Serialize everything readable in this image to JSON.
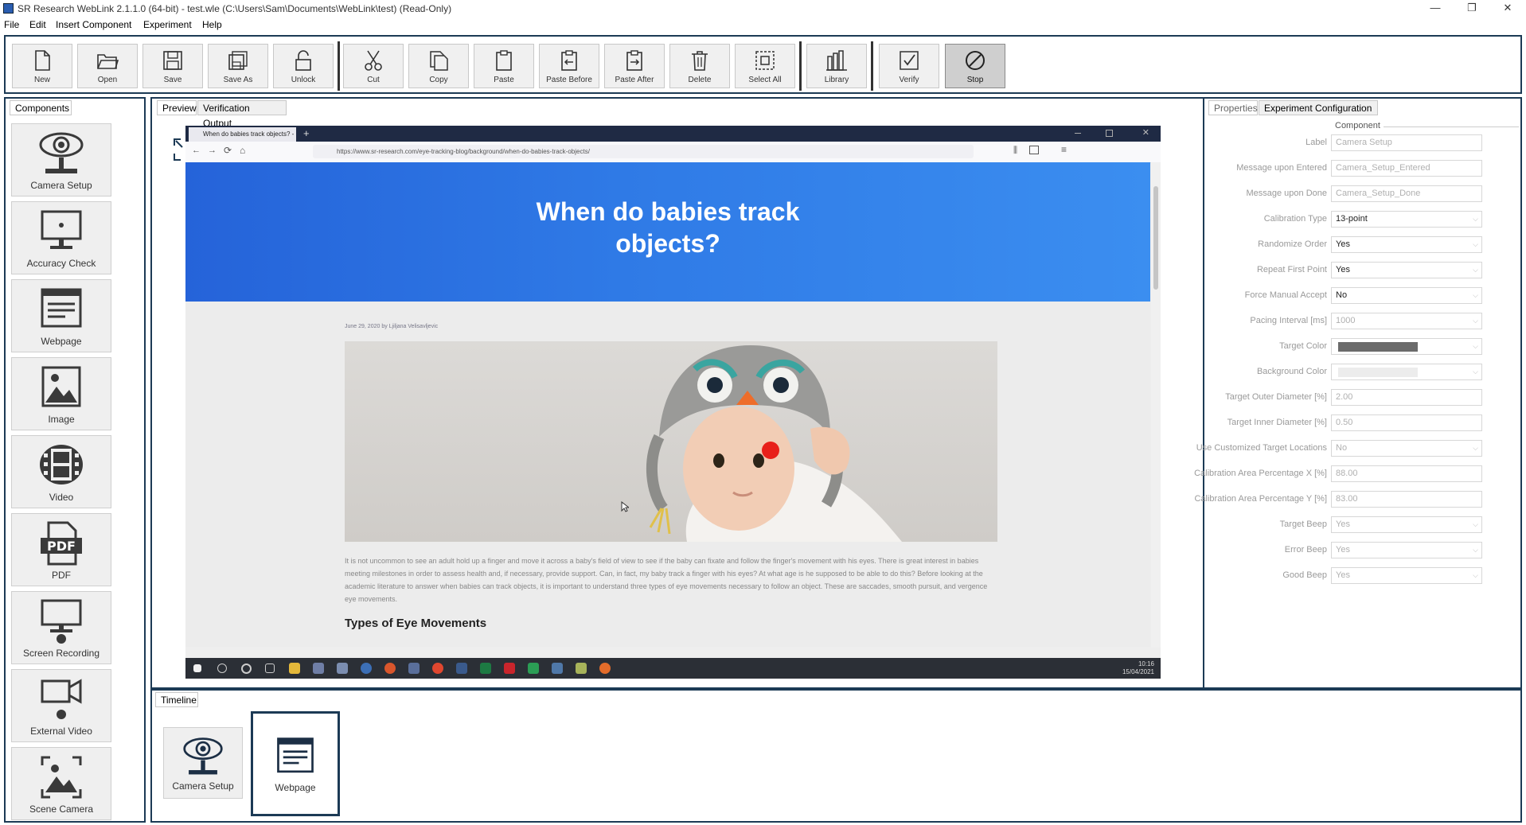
{
  "window": {
    "title": "SR Research WebLink 2.1.1.0 (64-bit) - test.wle (C:\\Users\\Sam\\Documents\\WebLink\\test) (Read-Only)",
    "controls": [
      "—",
      "❐",
      "✕"
    ]
  },
  "menu": [
    "File",
    "Edit",
    "Insert Component",
    "Experiment",
    "Help"
  ],
  "toolbar": [
    {
      "label": "New",
      "icon": "new-file-icon"
    },
    {
      "label": "Open",
      "icon": "folder-open-icon"
    },
    {
      "label": "Save",
      "icon": "save-icon"
    },
    {
      "label": "Save As",
      "icon": "save-as-icon"
    },
    {
      "label": "Unlock",
      "icon": "unlock-icon"
    },
    {
      "label": "Cut",
      "icon": "scissors-icon"
    },
    {
      "label": "Copy",
      "icon": "copy-icon"
    },
    {
      "label": "Paste",
      "icon": "clipboard-icon"
    },
    {
      "label": "Paste Before",
      "icon": "paste-before-icon"
    },
    {
      "label": "Paste After",
      "icon": "paste-after-icon"
    },
    {
      "label": "Delete",
      "icon": "trash-icon"
    },
    {
      "label": "Select All",
      "icon": "select-all-icon"
    },
    {
      "label": "Library",
      "icon": "library-icon"
    },
    {
      "label": "Verify",
      "icon": "check-icon"
    },
    {
      "label": "Stop",
      "icon": "stop-icon"
    }
  ],
  "components_panel": {
    "tab": "Components",
    "items": [
      "Camera Setup",
      "Accuracy Check",
      "Webpage",
      "Image",
      "Video",
      "PDF",
      "Screen Recording",
      "External Video",
      "Scene Camera"
    ]
  },
  "preview_panel": {
    "tabs": [
      "Preview",
      "Verification Output"
    ],
    "browser": {
      "tab_title": "When do babies track objects? -",
      "new_tab": "+",
      "url": "https://www.sr-research.com/eye-tracking-blog/background/when-do-babies-track-objects/",
      "hero_title": "When do babies track objects?",
      "byline": "June 29, 2020 by Ljiljana Velisavljevic",
      "body_text": "It is not uncommon to see an adult hold up a finger and move it across a baby's field of view to see if the baby can fixate and follow the finger's movement with his eyes. There is great interest in babies meeting milestones in order to assess health and, if necessary, provide support. Can, in fact, my baby track a finger with his eyes? At what age is he supposed to be able to do this? Before looking at the academic literature to answer when babies can track objects, it is important to understand three types of eye movements necessary to follow an object. These are saccades, smooth pursuit, and vergence eye movements.",
      "section_heading": "Types of Eye Movements",
      "clock_time": "10:16",
      "clock_date": "15/04/2021"
    }
  },
  "properties_panel": {
    "tabs": [
      "Properties",
      "Experiment Configuration"
    ],
    "group": "Component",
    "rows": [
      {
        "label": "Label",
        "value": "Camera Setup",
        "type": "text"
      },
      {
        "label": "Message upon Entered",
        "value": "Camera_Setup_Entered",
        "type": "text"
      },
      {
        "label": "Message upon Done",
        "value": "Camera_Setup_Done",
        "type": "text"
      },
      {
        "label": "Calibration Type",
        "value": "13-point",
        "type": "select"
      },
      {
        "label": "Randomize Order",
        "value": "Yes",
        "type": "select"
      },
      {
        "label": "Repeat First Point",
        "value": "Yes",
        "type": "select"
      },
      {
        "label": "Force Manual Accept",
        "value": "No",
        "type": "select"
      },
      {
        "label": "Pacing Interval [ms]",
        "value": "1000",
        "type": "select"
      },
      {
        "label": "Target Color",
        "value": "",
        "type": "color",
        "color": "#6b6b6b"
      },
      {
        "label": "Background Color",
        "value": "",
        "type": "color",
        "color": "#ececec"
      },
      {
        "label": "Target Outer Diameter [%]",
        "value": "2.00",
        "type": "text"
      },
      {
        "label": "Target Inner Diameter [%]",
        "value": "0.50",
        "type": "text"
      },
      {
        "label": "Use Customized Target Locations",
        "value": "No",
        "type": "select"
      },
      {
        "label": "Calibration Area Percentage X [%]",
        "value": "88.00",
        "type": "text"
      },
      {
        "label": "Calibration Area Percentage Y [%]",
        "value": "83.00",
        "type": "text"
      },
      {
        "label": "Target Beep",
        "value": "Yes",
        "type": "select"
      },
      {
        "label": "Error Beep",
        "value": "Yes",
        "type": "select"
      },
      {
        "label": "Good Beep",
        "value": "Yes",
        "type": "select"
      }
    ]
  },
  "timeline_panel": {
    "tab": "Timeline",
    "items": [
      "Camera Setup",
      "Webpage"
    ]
  },
  "colors": {
    "panel_border": "#1c3a55",
    "icon": "#3a3a3a",
    "hero": "#2f7ae6",
    "gaze_dot": "#e8201a"
  }
}
